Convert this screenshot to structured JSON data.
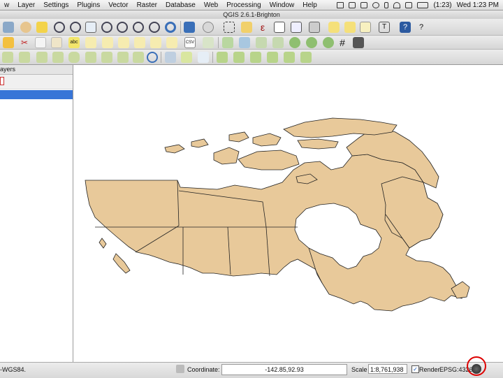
{
  "menubar": {
    "items": [
      "w",
      "Layer",
      "Settings",
      "Plugins",
      "Vector",
      "Raster",
      "Database",
      "Web",
      "Processing",
      "Window",
      "Help"
    ],
    "battery": "(1:23)",
    "clock": "Wed 1:23 PM"
  },
  "window": {
    "title": "QGIS 2.6.1-Brighton"
  },
  "layers_panel": {
    "title": "ayers"
  },
  "statusbar": {
    "crs_text": "-WGS84.",
    "coordinate_label": "Coordinate:",
    "coordinate_value": "-142.85,92.93",
    "scale_label": "Scale",
    "scale_value": "1:8,761,938",
    "render_label": "Render",
    "render_checked": true,
    "epsg": "EPSG:4326"
  },
  "map": {
    "fill_color": "#e8c99a",
    "stroke_color": "#222222",
    "background": "#ffffff"
  },
  "annotation": {
    "ring_color": "#dd0000"
  }
}
